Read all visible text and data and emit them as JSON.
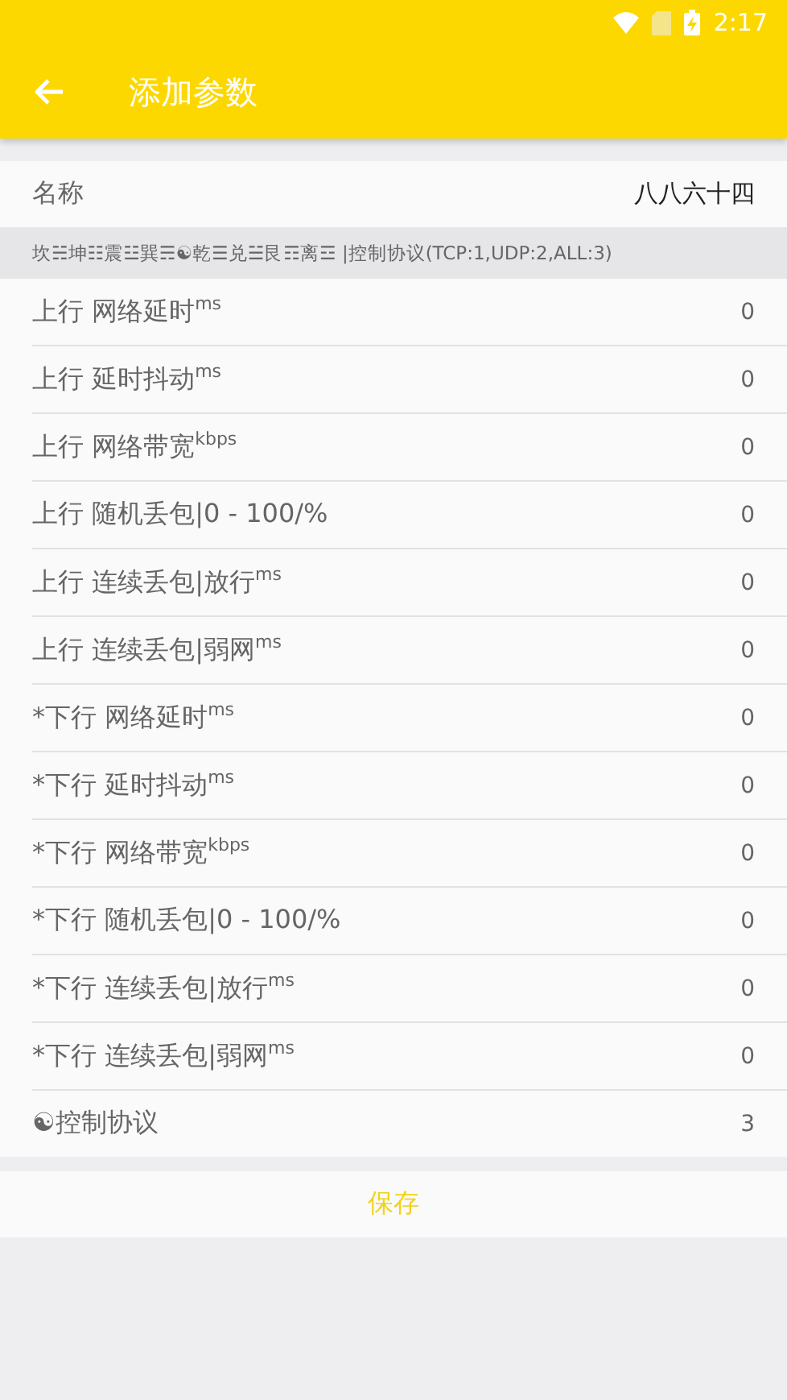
{
  "status_bar": {
    "time": "2:17"
  },
  "toolbar": {
    "title": "添加参数"
  },
  "name_row": {
    "label": "名称",
    "value": "八八六十四"
  },
  "hint": "坎☵坤☷震☳巽☴☯乾☰兑☱艮☶离☲ |控制协议(TCP:1,UDP:2,ALL:3)",
  "rows": [
    {
      "label": "上行 网络延时$^{ms}$",
      "value": "0"
    },
    {
      "label": "上行 延时抖动$^{ms}$",
      "value": "0"
    },
    {
      "label": "上行 网络带宽$^{kbps}$",
      "value": "0"
    },
    {
      "label": "上行 随机丢包|0 - 100/%",
      "value": "0"
    },
    {
      "label": "上行 连续丢包|放行$^{ms}$",
      "value": "0"
    },
    {
      "label": "上行 连续丢包|弱网$^{ms}$",
      "value": "0"
    },
    {
      "label": "*下行 网络延时$^{ms}$",
      "value": "0"
    },
    {
      "label": "*下行 延时抖动$^{ms}$",
      "value": "0"
    },
    {
      "label": "*下行 网络带宽$^{kbps}$",
      "value": "0"
    },
    {
      "label": "*下行 随机丢包|0 - 100/%",
      "value": "0"
    },
    {
      "label": "*下行 连续丢包|放行$^{ms}$",
      "value": "0"
    },
    {
      "label": "*下行 连续丢包|弱网$^{ms}$",
      "value": "0"
    },
    {
      "label": "☯控制协议",
      "value": "3"
    }
  ],
  "save_button": "保存"
}
